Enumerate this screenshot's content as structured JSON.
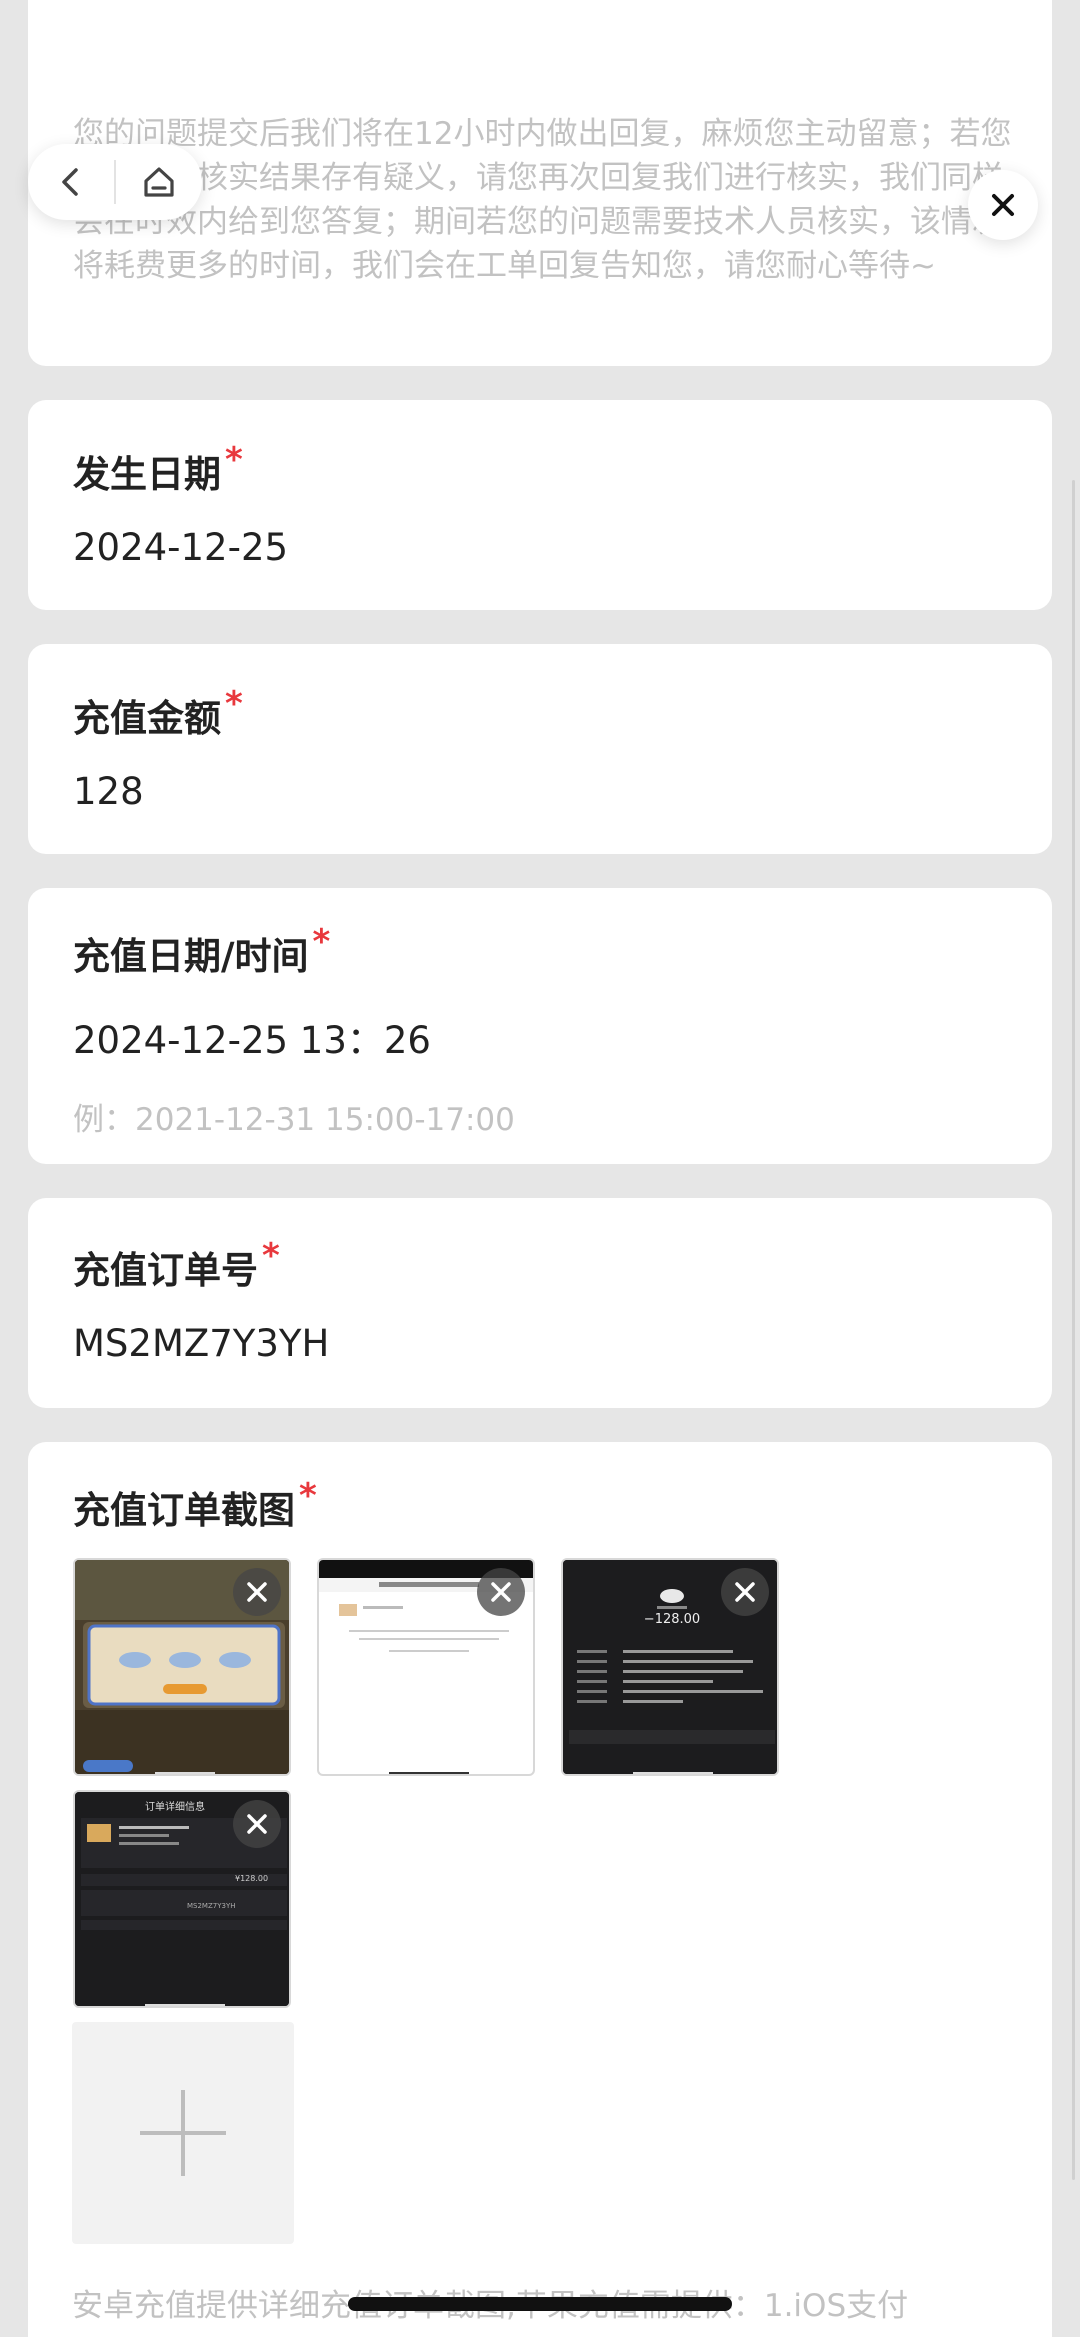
{
  "notice": {
    "text": "您的问题提交后我们将在12小时内做出回复，麻烦您主动留意；若您对我们的核实结果存有疑义，请您再次回复我们进行核实，我们同样会在时效内给到您答复；期间若您的问题需要技术人员核实，该情况将耗费更多的时间，我们会在工单回复告知您，请您耐心等待~"
  },
  "fields": {
    "date": {
      "label": "发生日期",
      "required": "*",
      "value": "2024-12-25"
    },
    "amount": {
      "label": "充值金额",
      "required": "*",
      "value": "128"
    },
    "datetime": {
      "label": "充值日期/时间",
      "required": "*",
      "value": "2024-12-25 13：26",
      "placeholder": "例：2021-12-31 15:00-17:00"
    },
    "order_no": {
      "label": "充值订单号",
      "required": "*",
      "value": "MS2MZ7Y3YH"
    },
    "screenshots": {
      "label": "充值订单截图",
      "required": "*"
    }
  },
  "thumbnails": {
    "t3_amount": "−128.00",
    "t4_title": "订单详细信息",
    "t4_total": "¥128.00",
    "t4_order": "MS2MZ7Y3YH"
  },
  "bottom_note": "安卓充值提供详细充值订单截图,苹果充值需提供：1.iOS支付",
  "icons": {
    "back": "chevron-left-icon",
    "home": "home-icon",
    "close": "close-icon",
    "remove": "remove-image-icon",
    "add": "plus-icon"
  },
  "colors": {
    "background": "#e6e6e6",
    "card": "#ffffff",
    "required": "#e8383d",
    "hint": "#c2c2c2"
  }
}
